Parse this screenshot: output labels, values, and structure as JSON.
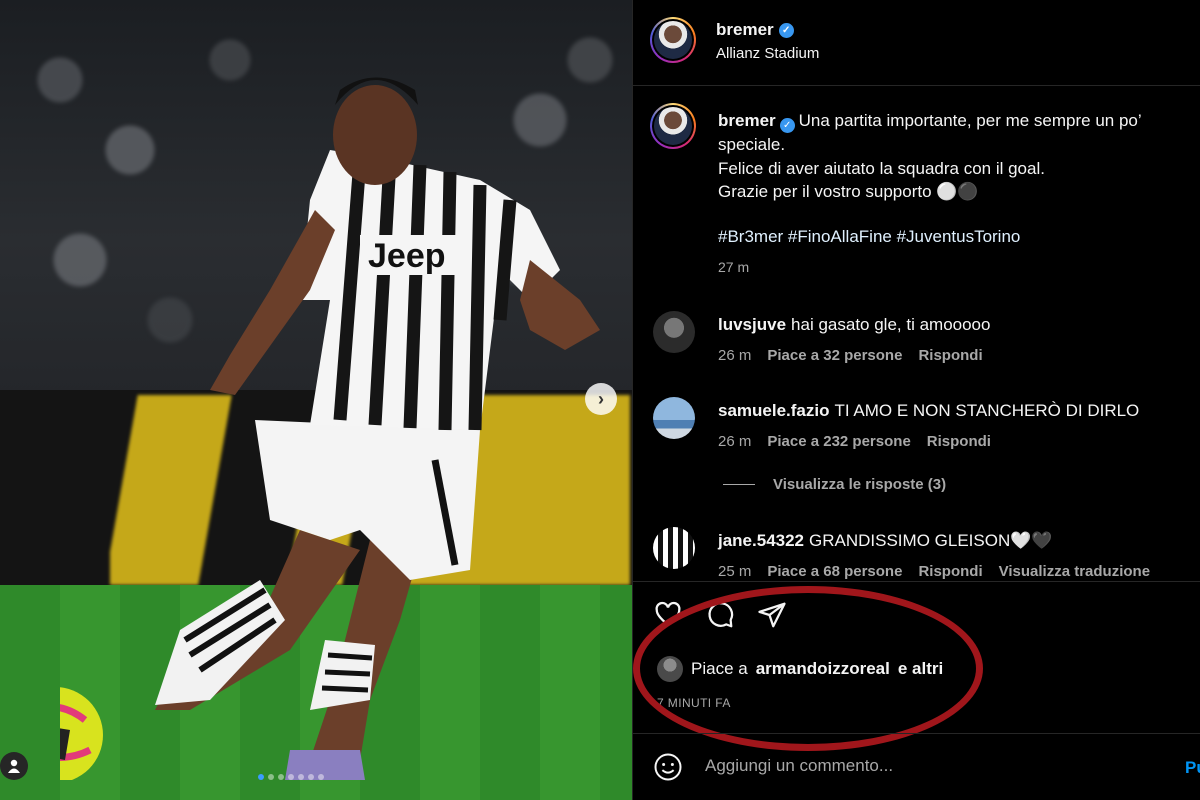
{
  "post": {
    "username": "bremer",
    "location": "Allianz Stadium",
    "caption_line1": "Una partita importante, per me sempre un po’",
    "caption_line2": "speciale.",
    "caption_line3": "Felice di aver aiutato la squadra con il goal.",
    "caption_line4": "Grazie per il vostro supporto ⚪⚫",
    "hashtags": "#Br3mer #FinoAllaFine #JuventusTorino",
    "time": "27 m"
  },
  "comments": [
    {
      "username": "luvsjuve",
      "text": "hai gasato gle, ti amooooo",
      "time": "26 m",
      "likes": "Piace a 32 persone",
      "reply": "Rispondi"
    },
    {
      "username": "samuele.fazio",
      "text": "TI AMO E NON STANCHERÒ DI DIRLO",
      "time": "26 m",
      "likes": "Piace a 232 persone",
      "reply": "Rispondi"
    },
    {
      "username": "jane.54322",
      "text": "GRANDISSIMO GLEISON🤍🖤",
      "time": "25 m",
      "likes": "Piace a 68 persone",
      "reply": "Rispondi",
      "translate": "Visualizza traduzione"
    }
  ],
  "view_replies": "Visualizza le risposte (3)",
  "likes_summary": {
    "prefix": "Piace a",
    "user": "armandoizzoreal",
    "suffix": "e altri"
  },
  "post_age": "7 MINUTI FA",
  "comment_box": {
    "placeholder": "Aggiungi un commento...",
    "publish": "Pu"
  },
  "carousel": {
    "total_dots": 7,
    "active_dot": 1
  },
  "icons": [
    "verified-badge-icon",
    "heart-icon",
    "comment-icon",
    "share-icon",
    "emoji-icon",
    "chevron-right-icon",
    "user-tag-icon"
  ],
  "colors": {
    "accent": "#0095f6",
    "verified": "#3897f0",
    "highlight_ellipse": "#a0161b"
  },
  "photo": {
    "shirt_text": "Jeep"
  }
}
